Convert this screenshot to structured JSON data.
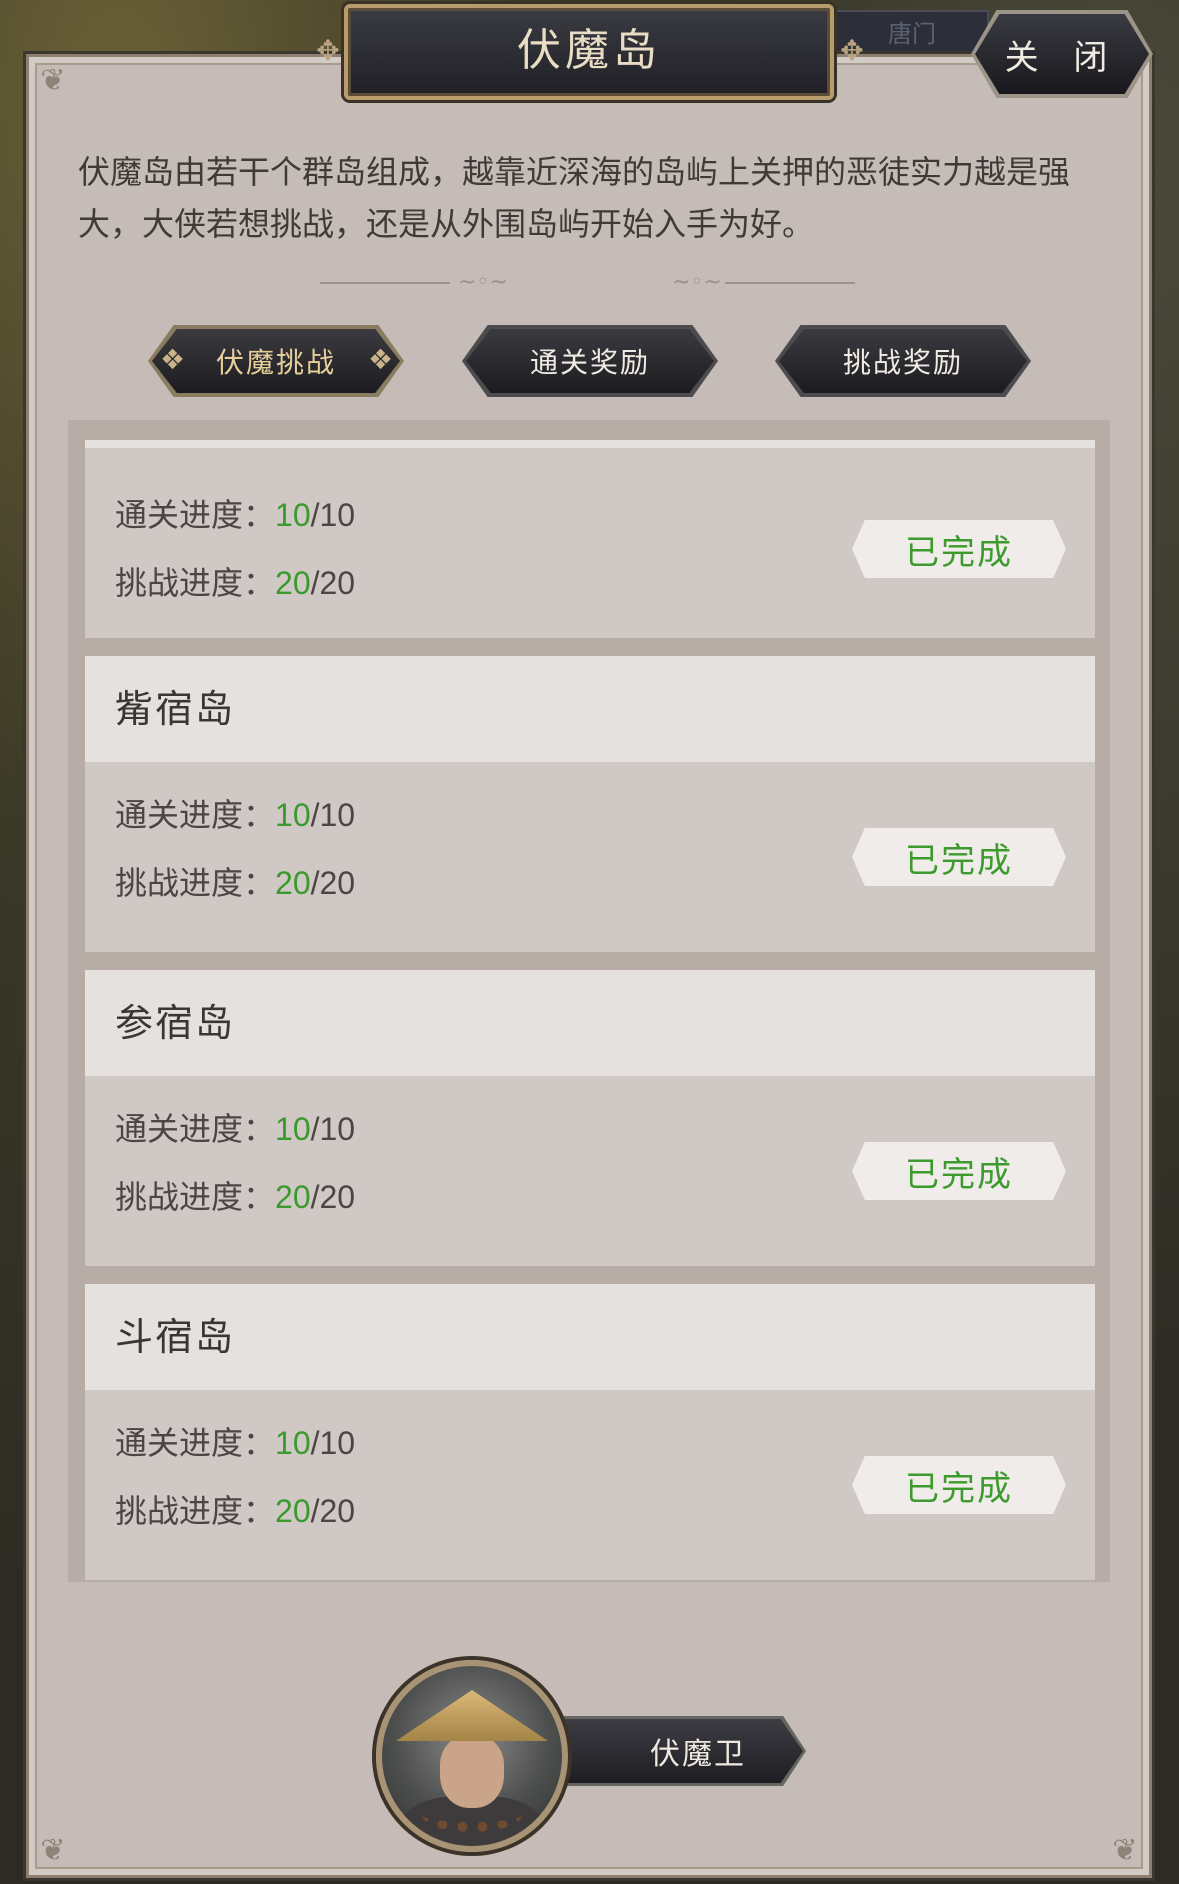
{
  "window": {
    "title": "伏魔岛",
    "close_label": "关 闭",
    "background_tab": "唐门"
  },
  "description": "伏魔岛由若干个群岛组成，越靠近深海的岛屿上关押的恶徒实力越是强大，大侠若想挑战，还是从外围岛屿开始入手为好。",
  "tabs": [
    {
      "label": "伏魔挑战",
      "active": true
    },
    {
      "label": "通关奖励",
      "active": false
    },
    {
      "label": "挑战奖励",
      "active": false
    }
  ],
  "labels": {
    "clear_progress": "通关进度：",
    "challenge_progress": "挑战进度："
  },
  "islands": [
    {
      "name": "",
      "clear_done": "10",
      "clear_total": "/10",
      "challenge_done": "20",
      "challenge_total": "/20",
      "status": "已完成"
    },
    {
      "name": "觜宿岛",
      "clear_done": "10",
      "clear_total": "/10",
      "challenge_done": "20",
      "challenge_total": "/20",
      "status": "已完成"
    },
    {
      "name": "参宿岛",
      "clear_done": "10",
      "clear_total": "/10",
      "challenge_done": "20",
      "challenge_total": "/20",
      "status": "已完成"
    },
    {
      "name": "斗宿岛",
      "clear_done": "10",
      "clear_total": "/10",
      "challenge_done": "20",
      "challenge_total": "/20",
      "status": "已完成"
    }
  ],
  "guard": {
    "label": "伏魔卫"
  },
  "colors": {
    "progress_green": "#3b9a2d",
    "panel_bg": "#c6bcb7",
    "gold_accent": "#b79d6e"
  }
}
